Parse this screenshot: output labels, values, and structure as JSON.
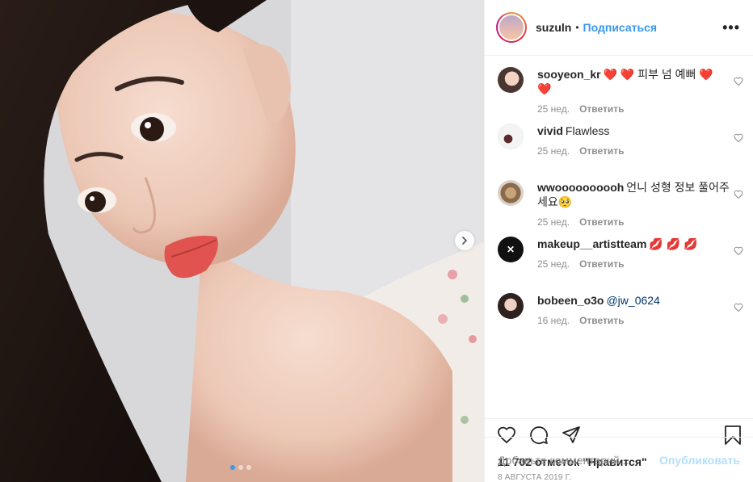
{
  "header": {
    "username": "suzuln",
    "separator": "•",
    "follow_label": "Подписаться",
    "more_label": "•••"
  },
  "comments": [
    {
      "user": "sooyeon_kr",
      "text": "❤️ ❤️ 피부 넘 예뻐 ❤️ ❤️",
      "age": "25 нед.",
      "reply": "Ответить"
    },
    {
      "user": "vivid",
      "text": "Flawless",
      "age": "25 нед.",
      "reply": "Ответить"
    },
    {
      "user": "wwoooooooooh",
      "text": "언니 성형 정보 풀어주세요🥺",
      "age": "25 нед.",
      "reply": "Ответить"
    },
    {
      "user": "makeup__artistteam",
      "text": "💋 💋 💋",
      "age": "25 нед.",
      "reply": "Ответить"
    },
    {
      "user": "bobeen_o3o",
      "mention": "@jw_0624",
      "age": "16 нед.",
      "reply": "Ответить"
    }
  ],
  "likes": "11 702 отметок \"Нравится\"",
  "date": "8 АВГУСТА 2019 Г.",
  "add_comment": {
    "placeholder": "Добавьте комментарий...",
    "publish_label": "Опубликовать"
  },
  "carousel": {
    "count": 3,
    "active_index": 0
  },
  "colors": {
    "accent": "#3897f0",
    "text": "#262626",
    "muted": "#8e8e8e",
    "publish_disabled": "#b2dffc"
  }
}
